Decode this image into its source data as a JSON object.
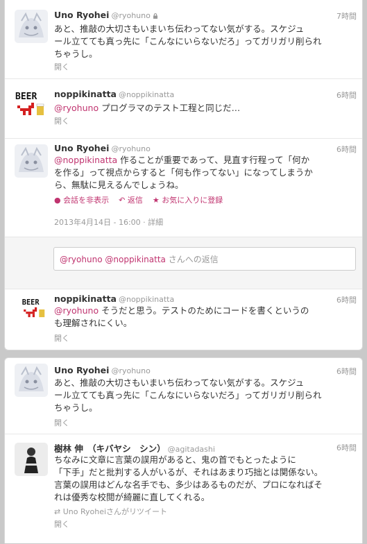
{
  "colors": {
    "link": "#c0336f",
    "muted": "#999999",
    "text": "#333333",
    "background": "#c9c9c9"
  },
  "block1": {
    "t1": {
      "name": "Uno Ryohei",
      "screen": "@ryohuno",
      "time": "7時間",
      "line1": "あと、推敲の大切さもいまいち伝わってない気がする。スケジュ",
      "line2": "ール立てても真っ先に「こんなにいらないだろ」ってガリガリ削られ",
      "line3": "ちゃうし。",
      "open": "開く"
    },
    "t2": {
      "name": "noppikinatta",
      "screen": "@noppikinatta",
      "time": "6時間",
      "mention": "@ryohuno",
      "text": " プログラマのテスト工程と同じだ…",
      "open": "開く"
    },
    "t3": {
      "name": "Uno Ryohei",
      "screen": "@ryohuno",
      "time": "6時間",
      "mention": "@noppikinatta",
      "line1": " 作ることが重要であって、見直す行程って「何か",
      "line2": "を作る」って視点からすると「何も作ってない」になってしまうか",
      "line3": "ら、無駄に見えるんでしょうね。",
      "hide": "会話を非表示",
      "reply": "返信",
      "fav": "お気に入りに登録",
      "date": "2013年4月14日 - 16:00",
      "sep": " · ",
      "details": "詳細"
    },
    "reply": {
      "mention1": "@ryohuno",
      "mention2": "@noppikinatta",
      "suffix": " さんへの返信"
    },
    "t4": {
      "name": "noppikinatta",
      "screen": "@noppikinatta",
      "time": "6時間",
      "mention": "@ryohuno",
      "line1": " そうだと思う。テストのためにコードを書くというの",
      "line2": "も理解されにくい。",
      "open": "開く"
    }
  },
  "block2": {
    "t5": {
      "name": "Uno Ryohei",
      "screen": "@ryohuno",
      "time": "6時間",
      "line1": "あと、推敲の大切さもいまいち伝わってない気がする。スケジュ",
      "line2": "ール立てても真っ先に「こんなにいらないだろ」ってガリガリ削られ",
      "line3": "ちゃうし。",
      "open": "開く"
    },
    "t6": {
      "name": "樹林 伸　（キバヤシ　シン）",
      "screen": "@agitadashi",
      "time": "6時間",
      "line1": "ちなみに文章に言葉の誤用があると、鬼の首でもとったように",
      "line2": "「下手」だと批判する人がいるが、それはあまり巧拙とは関係ない。",
      "line3": "言葉の誤用はどんな名手でも、多少はあるものだが、プロになればそ",
      "line4": "れは優秀な校閲が綺麗に直してくれる。",
      "retweet": "Uno Ryoheiさんがリツイート",
      "open": "開く"
    }
  }
}
